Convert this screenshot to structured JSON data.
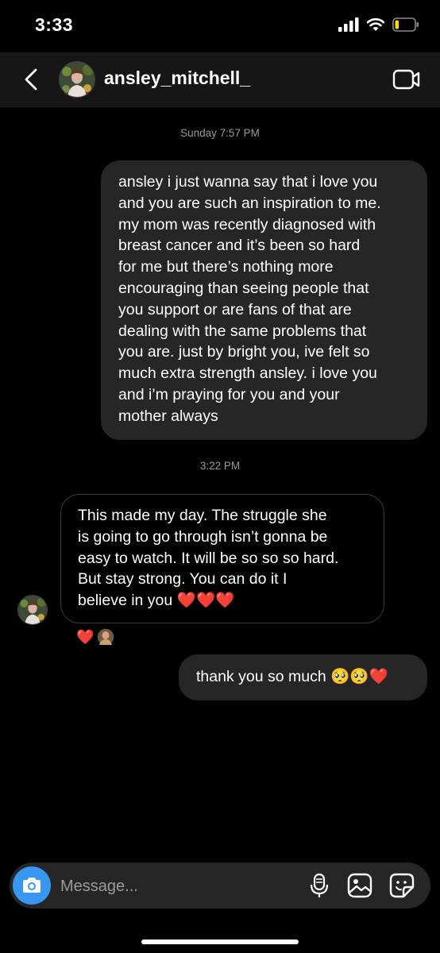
{
  "status_bar": {
    "time": "3:33",
    "battery_level": 0.2
  },
  "header": {
    "back_icon": "chevron-left-icon",
    "username": "ansley_mitchell_",
    "video_icon": "video-camera-icon"
  },
  "conversation": {
    "timestamp_1": "Sunday 7:57 PM",
    "message_1_lines": [
      "ansley i just wanna say that i love you",
      "and you are such an inspiration to me.",
      "my mom was recently diagnosed with",
      "breast cancer and it’s been so hard",
      "for me but there’s nothing more",
      "encouraging than seeing people that",
      "you support or are fans of that are",
      "dealing with the same problems that",
      "you are. just by bright you, ive felt so",
      "much extra strength ansley. i love you",
      "and i’m praying for you and your",
      "mother always"
    ],
    "timestamp_2": "3:22 PM",
    "message_2_lines": [
      "This made my day. The struggle she",
      "is going to go through isn’t gonna be",
      "easy to watch. It will be so so so hard.",
      "But stay strong. You can do it I",
      "believe in you ❤️❤️❤️"
    ],
    "reaction": "❤️",
    "message_3": "thank you so much 🥺🥺❤️"
  },
  "composer": {
    "placeholder": "Message...",
    "camera_icon": "camera-icon",
    "mic_icon": "microphone-icon",
    "gallery_icon": "image-icon",
    "sticker_icon": "sticker-icon"
  },
  "colors": {
    "background": "#000000",
    "bubble_outgoing": "#262626",
    "camera_button": "#3897f0",
    "timestamp": "#9a9a9a",
    "heart": "#e0334b"
  }
}
